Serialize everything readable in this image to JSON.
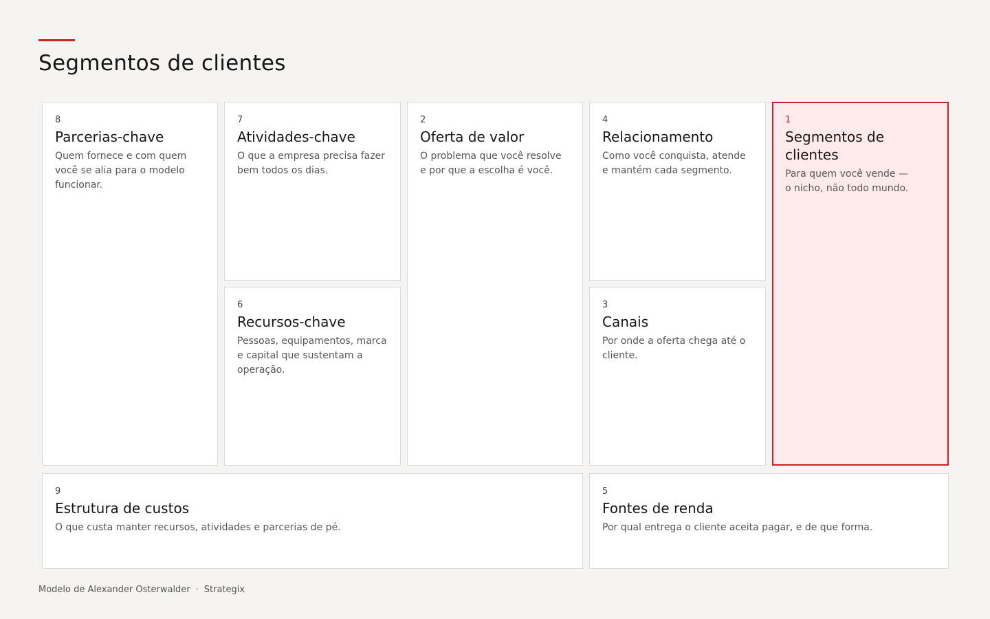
{
  "header": {
    "title": "Segmentos de clientes"
  },
  "blocks": {
    "parcerias": {
      "number": "8",
      "title": "Parcerias-chave",
      "description": "Quem fornece e com quem você se alia para o modelo funcionar."
    },
    "atividades": {
      "number": "7",
      "title": "Atividades-chave",
      "description": "O que a empresa precisa fazer bem todos os dias."
    },
    "recursos": {
      "number": "6",
      "title": "Recursos-chave",
      "description": "Pessoas, equipamentos, marca e capital que sustentam a operação."
    },
    "oferta": {
      "number": "2",
      "title": "Oferta de valor",
      "description": "O problema que você resolve e por que a escolha é você."
    },
    "relacionamento": {
      "number": "4",
      "title": "Relacionamento",
      "description": "Como você conquista, atende e mantém cada segmento."
    },
    "canais": {
      "number": "3",
      "title": "Canais",
      "description": "Por onde a oferta chega até o cliente."
    },
    "segmentos": {
      "number": "1",
      "title": "Segmentos de clientes",
      "description": "Para quem você vende — o nicho, não todo mundo."
    },
    "custos": {
      "number": "9",
      "title": "Estrutura de custos",
      "description": "O que custa manter recursos, atividades e parcerias de pé."
    },
    "renda": {
      "number": "5",
      "title": "Fontes de renda",
      "description": "Por qual entrega o cliente aceita pagar, e de que forma."
    }
  },
  "footer": {
    "author": "Modelo de Alexander Osterwalder",
    "separator": "·",
    "brand": "Strategix"
  },
  "colors": {
    "accent": "#d0201f",
    "active_bg": "#feeaea",
    "page_bg": "#f5f4f2"
  }
}
